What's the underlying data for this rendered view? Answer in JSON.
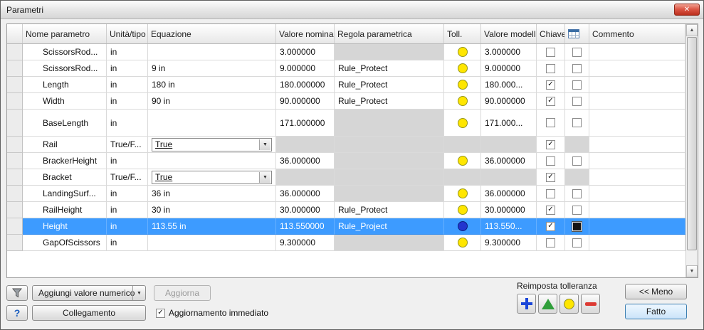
{
  "window": {
    "title": "Parametri"
  },
  "icons": {
    "close": "✕",
    "dropdown": "▼",
    "check": "✓",
    "help": "?",
    "scroll_up": "▲",
    "scroll_down": "▼"
  },
  "colors": {
    "selection": "#3d9bff",
    "toll_yellow": "#ffe600",
    "toll_blue": "#2335cf",
    "gray_cell": "#d6d6d6"
  },
  "table": {
    "headers": {
      "name": "Nome parametro",
      "unit": "Unità/tipo",
      "equation": "Equazione",
      "nominal": "Valore nominale",
      "rule": "Regola parametrica",
      "toll": "Toll.",
      "model": "Valore modello",
      "key": "Chiave",
      "comment": "Commento"
    },
    "rows": [
      {
        "name": "ScissorsRod...",
        "unit": "in",
        "equation": "",
        "nominal": "3.000000",
        "rule": null,
        "toll": "yellow",
        "model": "3.000000",
        "key": false,
        "export": false,
        "comment": ""
      },
      {
        "name": "ScissorsRod...",
        "unit": "in",
        "equation": "9 in",
        "nominal": "9.000000",
        "rule": "Rule_Protect",
        "toll": "yellow",
        "model": "9.000000",
        "key": false,
        "export": false,
        "comment": ""
      },
      {
        "name": "Length",
        "unit": "in",
        "equation": "180 in",
        "nominal": "180.000000",
        "rule": "Rule_Protect",
        "toll": "yellow",
        "model": "180.000...",
        "key": true,
        "export": false,
        "comment": ""
      },
      {
        "name": "Width",
        "unit": "in",
        "equation": "90 in",
        "nominal": "90.000000",
        "rule": "Rule_Protect",
        "toll": "yellow",
        "model": "90.000000",
        "key": true,
        "export": false,
        "comment": ""
      },
      {
        "name": "BaseLength",
        "unit": "in",
        "equation": "",
        "nominal": "171.000000",
        "rule": null,
        "toll": "yellow",
        "model": "171.000...",
        "key": false,
        "export": false,
        "comment": "",
        "height": 38
      },
      {
        "name": "Rail",
        "unit": "True/F...",
        "equation": "True",
        "dropdown": true,
        "nominal": null,
        "rule": null,
        "toll": null,
        "model": null,
        "key": true,
        "export": null,
        "comment": ""
      },
      {
        "name": "BrackerHeight",
        "unit": "in",
        "equation": "",
        "nominal": "36.000000",
        "rule": null,
        "toll": "yellow",
        "model": "36.000000",
        "key": false,
        "export": false,
        "comment": ""
      },
      {
        "name": "Bracket",
        "unit": "True/F...",
        "equation": "True",
        "dropdown": true,
        "nominal": null,
        "rule": null,
        "toll": null,
        "model": null,
        "key": true,
        "export": null,
        "comment": ""
      },
      {
        "name": "LandingSurf...",
        "unit": "in",
        "equation": "36 in",
        "nominal": "36.000000",
        "rule": null,
        "toll": "yellow",
        "model": "36.000000",
        "key": false,
        "export": false,
        "comment": ""
      },
      {
        "name": "RailHeight",
        "unit": "in",
        "equation": "30 in",
        "nominal": "30.000000",
        "rule": "Rule_Protect",
        "toll": "yellow",
        "model": "30.000000",
        "key": true,
        "export": false,
        "comment": ""
      },
      {
        "name": "Height",
        "unit": "in",
        "equation": "113.55 in",
        "nominal": "113.550000",
        "rule": "Rule_Project",
        "toll": "blue",
        "model": "113.550...",
        "key": true,
        "export": "filled",
        "comment": "",
        "selected": true
      },
      {
        "name": "GapOfScissors",
        "unit": "in",
        "equation": "",
        "nominal": "9.300000",
        "rule": null,
        "toll": "yellow",
        "model": "9.300000",
        "key": false,
        "export": false,
        "comment": ""
      }
    ]
  },
  "footer": {
    "add_button": "Aggiungi valore numerico",
    "update_button": "Aggiorna",
    "link_button": "Collegamento",
    "immediate_update_label": "Aggiornamento immediato",
    "reset_tolerance_label": "Reimposta tolleranza",
    "less_button": "<< Meno",
    "done_button": "Fatto",
    "tolerance_buttons": [
      {
        "name": "tolerance-plus",
        "shape": "plus",
        "color": "#1a46d8"
      },
      {
        "name": "tolerance-triangle",
        "shape": "triangle",
        "color": "#2f9e3a"
      },
      {
        "name": "tolerance-circle",
        "shape": "circle",
        "color": "#ffe600"
      },
      {
        "name": "tolerance-minus",
        "shape": "minus",
        "color": "#dd3a33"
      }
    ]
  }
}
